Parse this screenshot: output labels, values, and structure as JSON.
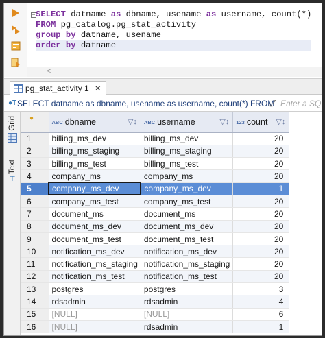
{
  "editor": {
    "lines": [
      [
        {
          "t": "SELECT",
          "k": 1
        },
        {
          "t": " datname "
        },
        {
          "t": "as",
          "k": 1
        },
        {
          "t": " dbname, usename "
        },
        {
          "t": "as",
          "k": 1
        },
        {
          "t": " username, count(*)"
        }
      ],
      [
        {
          "t": "FROM",
          "k": 1
        },
        {
          "t": " pg_catalog.pg_stat_activity"
        }
      ],
      [
        {
          "t": "group",
          "k": 1
        },
        {
          "t": " "
        },
        {
          "t": "by",
          "k": 1
        },
        {
          "t": " datname, usename"
        }
      ],
      [
        {
          "t": "order",
          "k": 1
        },
        {
          "t": " "
        },
        {
          "t": "by",
          "k": 1
        },
        {
          "t": " datname"
        }
      ]
    ],
    "gutter_icons": [
      "execute-icon",
      "execute-script-icon",
      "explain-plan-icon",
      "format-sql-icon"
    ],
    "scroll_arrow": "<"
  },
  "results_tab": {
    "label": "pg_stat_activity 1",
    "close": "✕"
  },
  "filter": {
    "query_text": "SELECT datname as dbname, usename as username, count(*) FROM",
    "hint": "Enter a SQ"
  },
  "side_panel": {
    "grid_label": "Grid",
    "text_label": "Text"
  },
  "grid": {
    "columns": [
      {
        "type": "ABC",
        "name": "dbname"
      },
      {
        "type": "ABC",
        "name": "username"
      },
      {
        "type": "123",
        "name": "count"
      }
    ],
    "rows": [
      {
        "n": "1",
        "db": "billing_ms_dev",
        "user": "billing_ms_dev",
        "count": "20"
      },
      {
        "n": "2",
        "db": "billing_ms_staging",
        "user": "billing_ms_staging",
        "count": "20"
      },
      {
        "n": "3",
        "db": "billing_ms_test",
        "user": "billing_ms_test",
        "count": "20"
      },
      {
        "n": "4",
        "db": "company_ms",
        "user": "company_ms",
        "count": "20"
      },
      {
        "n": "5",
        "db": "company_ms_dev",
        "user": "company_ms_dev",
        "count": "1"
      },
      {
        "n": "6",
        "db": "company_ms_test",
        "user": "company_ms_test",
        "count": "20"
      },
      {
        "n": "7",
        "db": "document_ms",
        "user": "document_ms",
        "count": "20"
      },
      {
        "n": "8",
        "db": "document_ms_dev",
        "user": "document_ms_dev",
        "count": "20"
      },
      {
        "n": "9",
        "db": "document_ms_test",
        "user": "document_ms_test",
        "count": "20"
      },
      {
        "n": "10",
        "db": "notification_ms_dev",
        "user": "notification_ms_dev",
        "count": "20"
      },
      {
        "n": "11",
        "db": "notification_ms_staging",
        "user": "notification_ms_staging",
        "count": "20"
      },
      {
        "n": "12",
        "db": "notification_ms_test",
        "user": "notification_ms_test",
        "count": "20"
      },
      {
        "n": "13",
        "db": "postgres",
        "user": "postgres",
        "count": "3"
      },
      {
        "n": "14",
        "db": "rdsadmin",
        "user": "rdsadmin",
        "count": "4"
      },
      {
        "n": "15",
        "db": "[NULL]",
        "user": "[NULL]",
        "count": "6"
      },
      {
        "n": "16",
        "db": "[NULL]",
        "user": "rdsadmin",
        "count": "1"
      }
    ],
    "selected_row": 4,
    "colors": {
      "selection": "#5b8dd6",
      "header": "#e6eaf3",
      "keyword": "#7b2f9c"
    }
  }
}
